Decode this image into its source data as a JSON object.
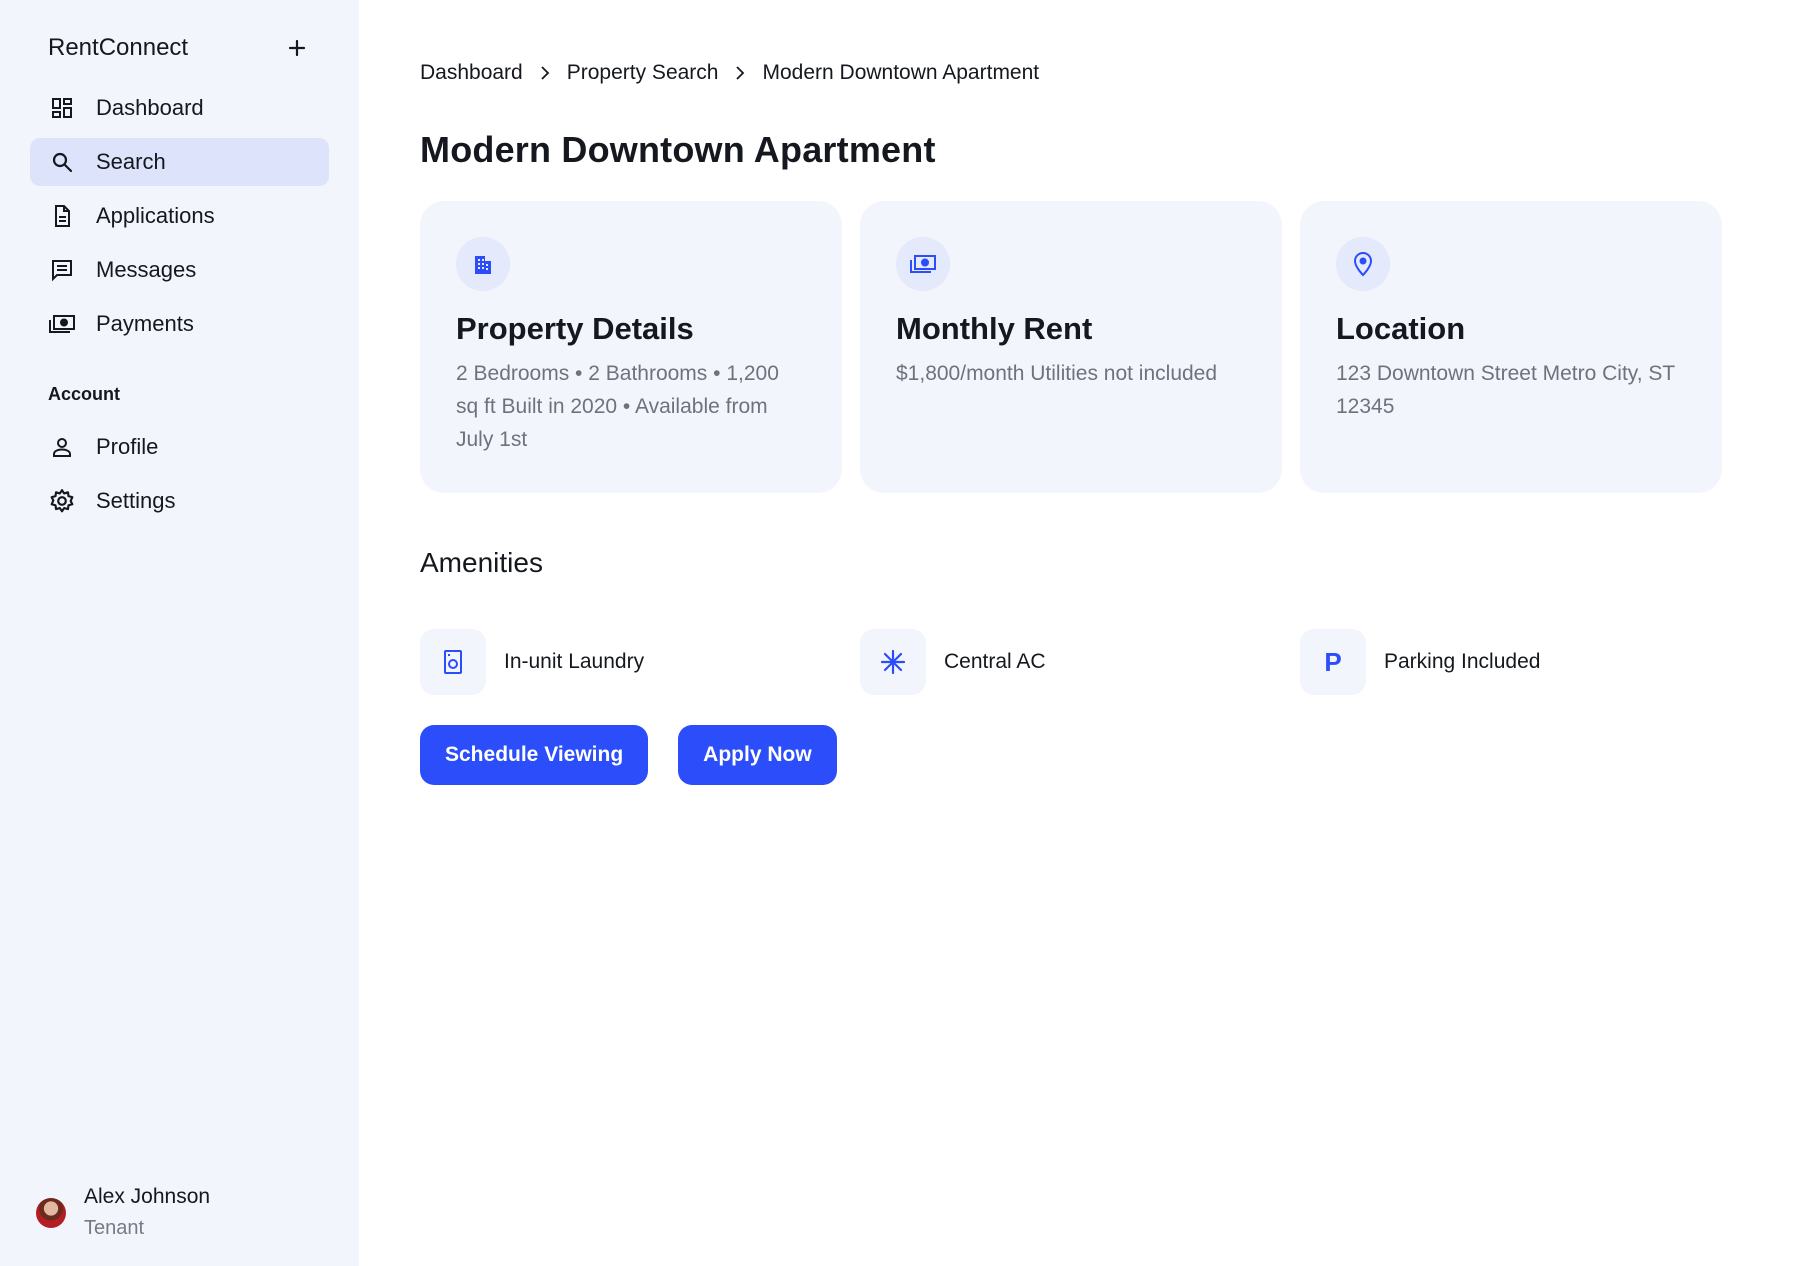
{
  "app": {
    "name": "RentConnect"
  },
  "sidebar": {
    "items": [
      {
        "label": "Dashboard",
        "icon": "dashboard-icon"
      },
      {
        "label": "Search",
        "icon": "search-icon",
        "active": true
      },
      {
        "label": "Applications",
        "icon": "document-icon"
      },
      {
        "label": "Messages",
        "icon": "message-icon"
      },
      {
        "label": "Payments",
        "icon": "payments-icon"
      }
    ],
    "account_label": "Account",
    "account_items": [
      {
        "label": "Profile",
        "icon": "person-icon"
      },
      {
        "label": "Settings",
        "icon": "gear-icon"
      }
    ],
    "user": {
      "name": "Alex Johnson",
      "role": "Tenant"
    }
  },
  "breadcrumb": [
    "Dashboard",
    "Property Search",
    "Modern Downtown Apartment"
  ],
  "page": {
    "title": "Modern Downtown Apartment"
  },
  "cards": [
    {
      "icon": "building-icon",
      "title": "Property Details",
      "text": "2 Bedrooms • 2 Bathrooms • 1,200 sq ft Built in 2020 • Available from July 1st"
    },
    {
      "icon": "money-icon",
      "title": "Monthly Rent",
      "text": "$1,800/month Utilities not included"
    },
    {
      "icon": "location-pin-icon",
      "title": "Location",
      "text": "123 Downtown Street Metro City, ST 12345"
    }
  ],
  "amenities": {
    "title": "Amenities",
    "items": [
      {
        "label": "In-unit Laundry",
        "icon": "washer-icon"
      },
      {
        "label": "Central AC",
        "icon": "snowflake-icon"
      },
      {
        "label": "Parking Included",
        "icon": "parking-icon",
        "glyph": "P"
      }
    ]
  },
  "actions": {
    "schedule": "Schedule Viewing",
    "apply": "Apply Now"
  },
  "colors": {
    "accent": "#2b4dfa",
    "sidebar_bg": "#f3f5fd",
    "active_bg": "#dde3fa",
    "muted_text": "#6e727d"
  }
}
